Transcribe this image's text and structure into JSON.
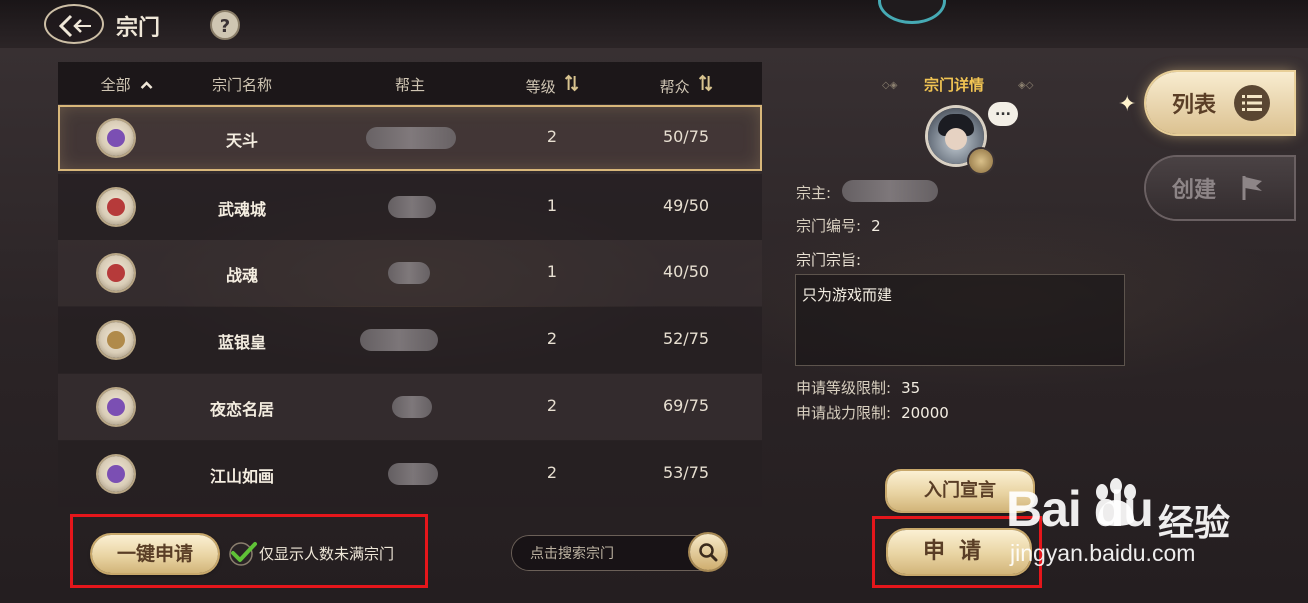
{
  "header": {
    "title": "宗门",
    "help_label": "?"
  },
  "table": {
    "columns": [
      "全部",
      "宗门名称",
      "帮主",
      "等级",
      "帮众"
    ],
    "rows": [
      {
        "name": "天斗",
        "level": "2",
        "members": "50/75",
        "emblem_color": "#7b4fb3",
        "selected": true
      },
      {
        "name": "武魂城",
        "level": "1",
        "members": "49/50",
        "emblem_color": "#b63a3a",
        "selected": false
      },
      {
        "name": "战魂",
        "level": "1",
        "members": "40/50",
        "emblem_color": "#b63a3a",
        "selected": false
      },
      {
        "name": "蓝银皇",
        "level": "2",
        "members": "52/75",
        "emblem_color": "#b08a4a",
        "selected": false
      },
      {
        "name": "夜恋名居",
        "level": "2",
        "members": "69/75",
        "emblem_color": "#7b4fb3",
        "selected": false
      },
      {
        "name": "江山如画",
        "level": "2",
        "members": "53/75",
        "emblem_color": "#7b4fb3",
        "selected": false
      }
    ]
  },
  "bottom": {
    "apply_all_label": "一键申请",
    "filter_label": "仅显示人数未满宗门",
    "filter_checked": true,
    "search_placeholder": "点击搜索宗门"
  },
  "detail": {
    "title": "宗门详情",
    "chat_icon": "...",
    "leader_label": "宗主:",
    "id_label": "宗门编号:",
    "id_value": "2",
    "motto_label": "宗门宗旨:",
    "motto_text": "只为游戏而建",
    "level_limit_label": "申请等级限制:",
    "level_limit_value": "35",
    "power_limit_label": "申请战力限制:",
    "power_limit_value": "20000",
    "declaration_button": "入门宣言",
    "apply_button": "申请"
  },
  "side_tabs": {
    "list_label": "列表",
    "create_label": "创建"
  },
  "watermark": {
    "logo": "Bai  du",
    "cn": "经验",
    "url": "jingyan.baidu.com"
  },
  "colors": {
    "accent_gold": "#f1c453",
    "highlight_red": "#e5161b",
    "check_green": "#5fc237"
  }
}
